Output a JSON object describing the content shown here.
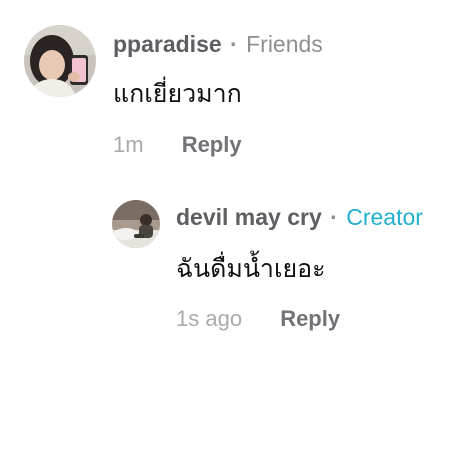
{
  "comments": [
    {
      "username": "pparadise",
      "separator": "·",
      "tag": "Friends",
      "text": "แกเยี่ยวมาก",
      "time": "1m",
      "reply_label": "Reply"
    },
    {
      "username": "devil may cry",
      "separator": "·",
      "tag": "Creator",
      "text": "ฉันดื่มน้ำเยอะ",
      "time": "1s ago",
      "reply_label": "Reply"
    }
  ],
  "colors": {
    "creator_tag": "#20b1cf",
    "username": "#5e5e63",
    "meta": "#a9a9ae"
  },
  "icons": {
    "avatar_1": "profile-photo-girl",
    "avatar_2": "profile-photo-person-on-bed"
  }
}
